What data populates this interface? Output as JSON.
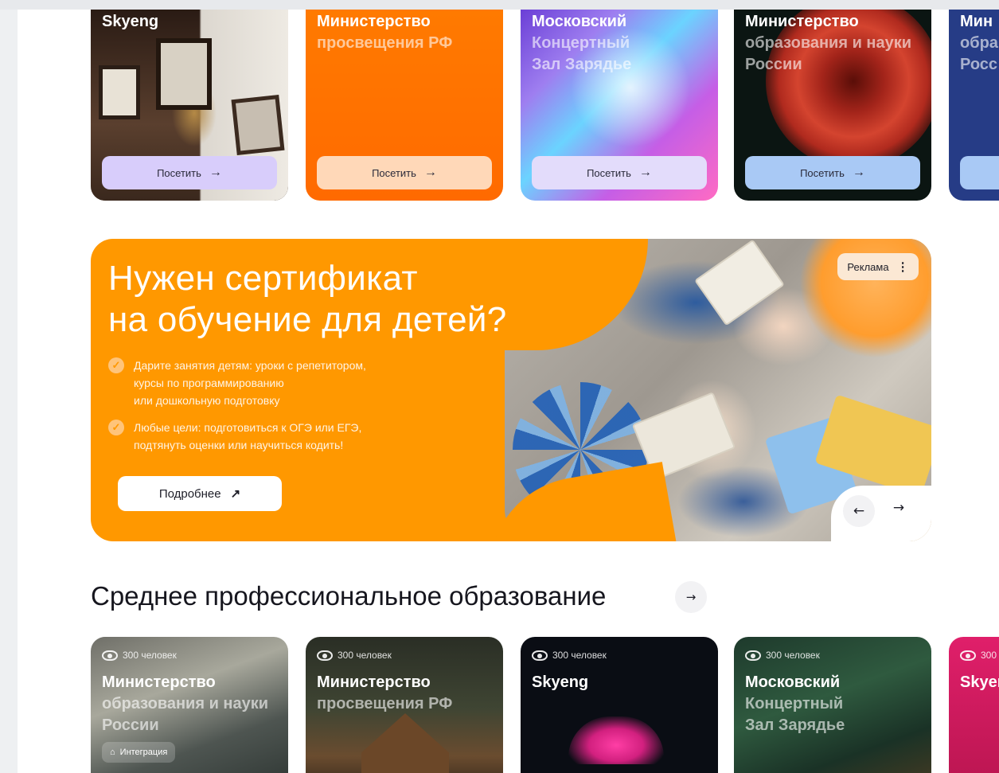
{
  "top_cards": [
    {
      "title_line1": "Skyeng",
      "title_line2": "",
      "title_line3": "",
      "button_label": "Посетить"
    },
    {
      "title_line1": "Министерство",
      "title_line2": "просвещения РФ",
      "title_line3": "",
      "button_label": "Посетить"
    },
    {
      "title_line1": "Московский",
      "title_line2": "Концертный",
      "title_line3": "Зал Зарядье",
      "button_label": "Посетить"
    },
    {
      "title_line1": "Министерство",
      "title_line2": "образования и науки",
      "title_line3": "России",
      "button_label": "Посетить"
    },
    {
      "title_line1": "Мин",
      "title_line2": "обра",
      "title_line3": "Росс",
      "button_label": ""
    }
  ],
  "banner": {
    "heading_line1": "Нужен сертификат",
    "heading_line2": "на обучение для детей?",
    "bullets": [
      {
        "line1": "Дарите занятия детям: уроки с репетитором,",
        "line2": "курсы по программированию",
        "line3": "или дошкольную подготовку"
      },
      {
        "line1": "Любые цели: подготовиться к ОГЭ или ЕГЭ,",
        "line2": "подтянуть оценки или научиться кодить!",
        "line3": ""
      }
    ],
    "button_label": "Подробнее",
    "ad_label": "Реклама"
  },
  "section": {
    "title": "Среднее профессиональное образование"
  },
  "bottom_cards": [
    {
      "views": "300 человек",
      "title_line1": "Министерство",
      "title_line2": "образования и науки",
      "title_line3": "России",
      "tag": "Интеграция"
    },
    {
      "views": "300 человек",
      "title_line1": "Министерство",
      "title_line2": "просвещения РФ",
      "title_line3": "",
      "tag": ""
    },
    {
      "views": "300 человек",
      "title_line1": "Skyeng",
      "title_line2": "",
      "title_line3": "",
      "tag": ""
    },
    {
      "views": "300 человек",
      "title_line1": "Московский",
      "title_line2": "Концертный",
      "title_line3": "Зал Зарядье",
      "tag": ""
    },
    {
      "views": "300",
      "title_line1": "Skyer",
      "title_line2": "",
      "title_line3": "",
      "tag": ""
    }
  ],
  "icons": {
    "arrow_right": "→",
    "arrow_left": "←",
    "arrow_up_right": "↗",
    "check": "✓",
    "dots": "⋮",
    "tag": "⌂"
  },
  "colors": {
    "banner_orange": "#ff9800",
    "card_orange": "#ff7a00",
    "card_navy": "#263c86",
    "text_dark": "#16161e"
  }
}
